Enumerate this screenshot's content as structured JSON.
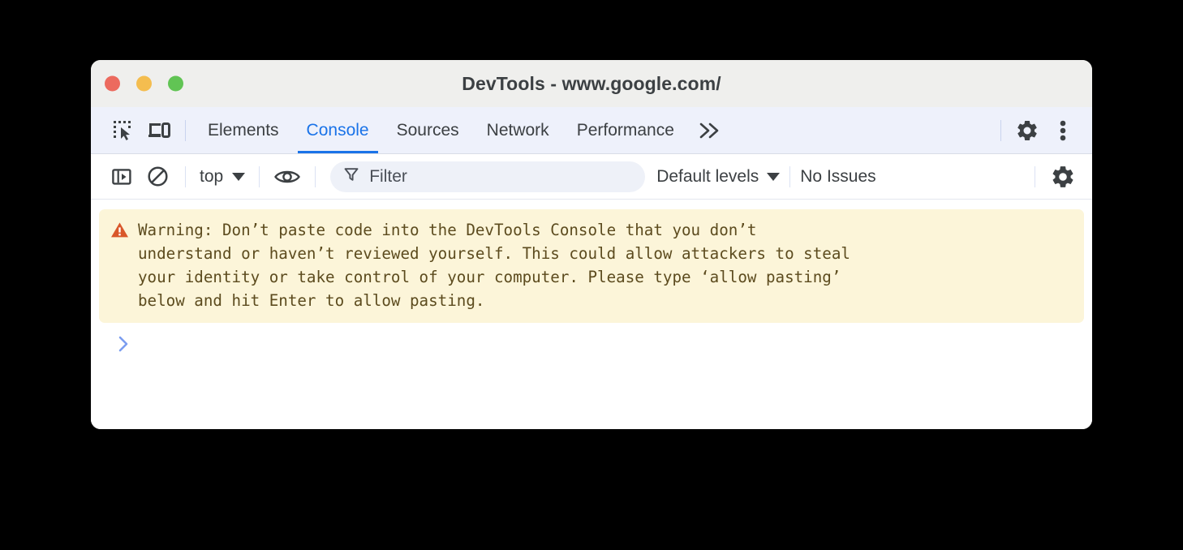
{
  "window": {
    "title": "DevTools - www.google.com/",
    "traffic_lights": [
      {
        "name": "close",
        "color": "#ec6a5e"
      },
      {
        "name": "minimize",
        "color": "#f4bd4f"
      },
      {
        "name": "maximize",
        "color": "#61c454"
      }
    ]
  },
  "tabbar": {
    "inspect_icon": "inspect-element-icon",
    "device_icon": "device-toolbar-icon",
    "tabs": [
      {
        "label": "Elements",
        "active": false
      },
      {
        "label": "Console",
        "active": true
      },
      {
        "label": "Sources",
        "active": false
      },
      {
        "label": "Network",
        "active": false
      },
      {
        "label": "Performance",
        "active": false
      }
    ],
    "overflow_label": "»",
    "settings_icon": "gear-icon",
    "more_icon": "three-dots-vertical-icon"
  },
  "console_toolbar": {
    "sidebar_toggle_icon": "console-sidebar-icon",
    "clear_icon": "clear-console-icon",
    "context_label": "top",
    "eye_icon": "live-expression-eye-icon",
    "filter_icon": "filter-funnel-icon",
    "filter_placeholder": "Filter",
    "filter_value": "",
    "levels_label": "Default levels",
    "issues_label": "No Issues",
    "settings_icon": "gear-icon"
  },
  "console": {
    "warning": {
      "icon": "warning-triangle-icon",
      "icon_color": "#d9572a",
      "background": "#fcf5d9",
      "text": "Warning: Don’t paste code into the DevTools Console that you don’t\nunderstand or haven’t reviewed yourself. This could allow attackers to steal\nyour identity or take control of your computer. Please type ‘allow pasting’\nbelow and hit Enter to allow pasting."
    },
    "prompt_symbol": "›"
  },
  "colors": {
    "titlebar_bg": "#efefed",
    "tabbar_bg": "#eef1fb",
    "toolbar_bg": "#ffffff",
    "accent_blue": "#1a73e8",
    "prompt_blue": "#7b9df0",
    "page_bg": "#000000"
  }
}
